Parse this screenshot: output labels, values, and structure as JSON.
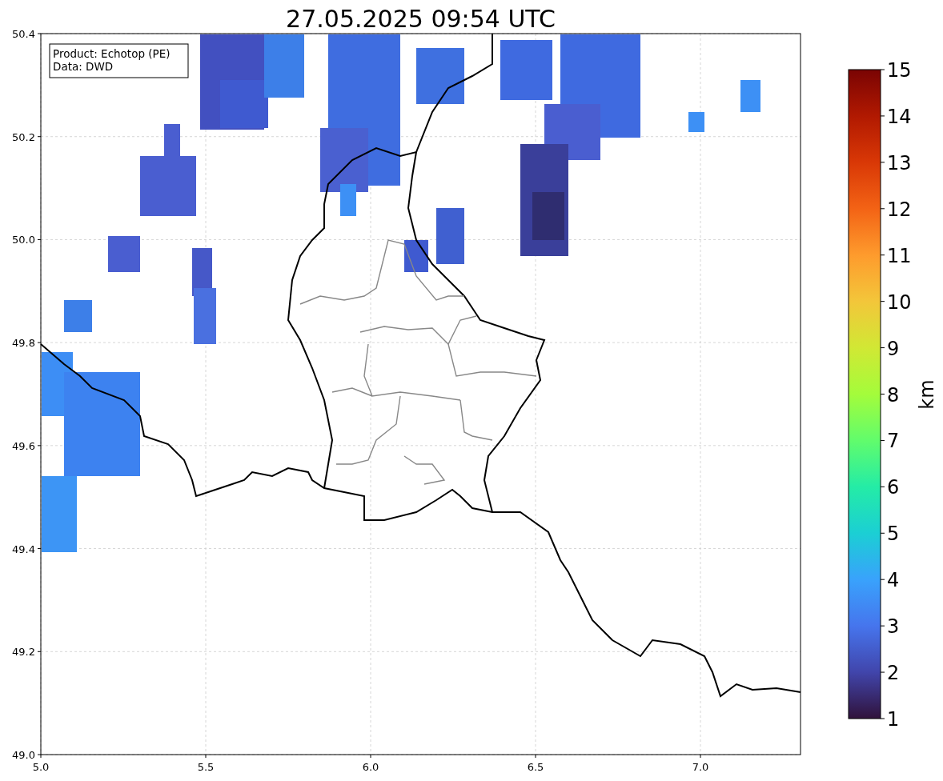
{
  "title": "27.05.2025 09:54 UTC",
  "legend": {
    "lines": [
      "Product: Echotop (PE)",
      "Data: DWD"
    ]
  },
  "x_ticks": [
    "5.0",
    "5.5",
    "6.0",
    "6.5",
    "7.0"
  ],
  "y_ticks": [
    "50.4",
    "50.2",
    "50.0",
    "49.8",
    "49.6",
    "49.4",
    "49.2",
    "49.0"
  ],
  "colorbar": {
    "label": "km",
    "ticks": [
      "15",
      "14",
      "13",
      "12",
      "11",
      "10",
      "9",
      "8",
      "7",
      "6",
      "5",
      "4",
      "3",
      "2",
      "1"
    ]
  }
}
